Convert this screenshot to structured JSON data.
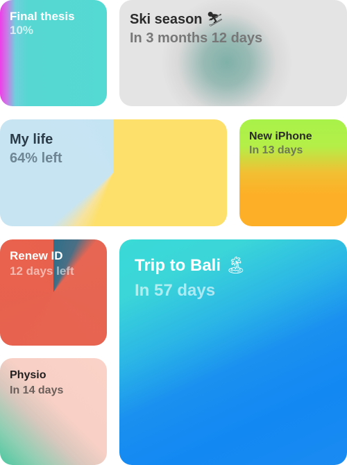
{
  "tiles": {
    "final_thesis": {
      "title": "Final thesis",
      "subtitle": "10%",
      "progress": 0.1
    },
    "ski_season": {
      "title": "Ski season",
      "emoji": "⛷",
      "subtitle": "In 3 months 12 days"
    },
    "my_life": {
      "title": "My life",
      "subtitle": "64% left",
      "remaining": 0.64
    },
    "new_iphone": {
      "title": "New iPhone",
      "subtitle": "In 13 days"
    },
    "renew_id": {
      "title": "Renew ID",
      "subtitle": "12 days left"
    },
    "trip_to_bali": {
      "title": "Trip to Bali",
      "emoji": "🏝",
      "subtitle": "In 57 days"
    },
    "physio": {
      "title": "Physio",
      "subtitle": "In 14 days"
    }
  },
  "colors": {
    "final_thesis": "#55d9d3",
    "ski_season": "#e4e4e4",
    "my_life": "#fde06b",
    "new_iphone": "#fdb027",
    "renew_id": "#e8614c",
    "trip_to_bali": "#1288f3",
    "physio": "#fad2c7"
  }
}
